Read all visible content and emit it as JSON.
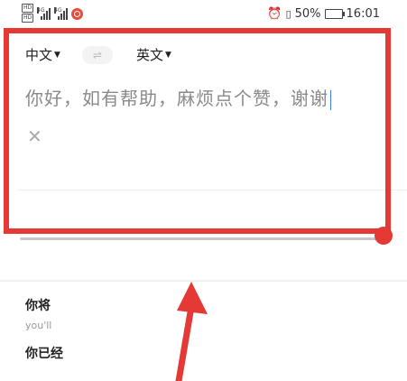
{
  "status_bar": {
    "network_labels": [
      "HD",
      "HD"
    ],
    "signal_labels": [
      "4G",
      "4G"
    ],
    "battery_percent": "50%",
    "battery_level": 0.5,
    "time": "16:01",
    "icons": [
      "alarm-icon",
      "vibrate-icon",
      "battery-icon",
      "notification-icon"
    ]
  },
  "translator": {
    "source_lang": "中文",
    "target_lang": "英文",
    "input_text": "你好，如有帮助，麻烦点个赞，谢谢",
    "swap_icon": "swap-icon",
    "clear_icon": "close-icon"
  },
  "suggestions": [
    {
      "main": "你将",
      "sub": "you'll"
    },
    {
      "main": "你已经",
      "sub": ""
    }
  ],
  "colors": {
    "highlight": "#e53935",
    "input_text": "#8a8a8a",
    "cursor": "#3a7afe"
  }
}
